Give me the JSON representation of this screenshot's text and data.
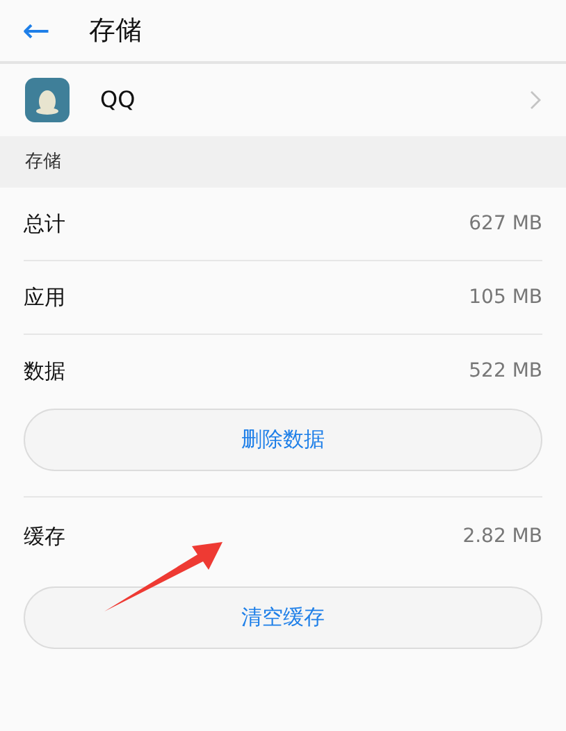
{
  "header": {
    "back": "←",
    "title": "存储"
  },
  "app": {
    "name": "QQ"
  },
  "section": {
    "title": "存储"
  },
  "rows": [
    {
      "label": "总计",
      "value": "627 MB"
    },
    {
      "label": "应用",
      "value": "105 MB"
    },
    {
      "label": "数据",
      "value": "522 MB"
    }
  ],
  "clear_data_button": "删除数据",
  "cache": {
    "label": "缓存",
    "value": "2.82 MB"
  },
  "clear_cache_button": "清空缓存"
}
